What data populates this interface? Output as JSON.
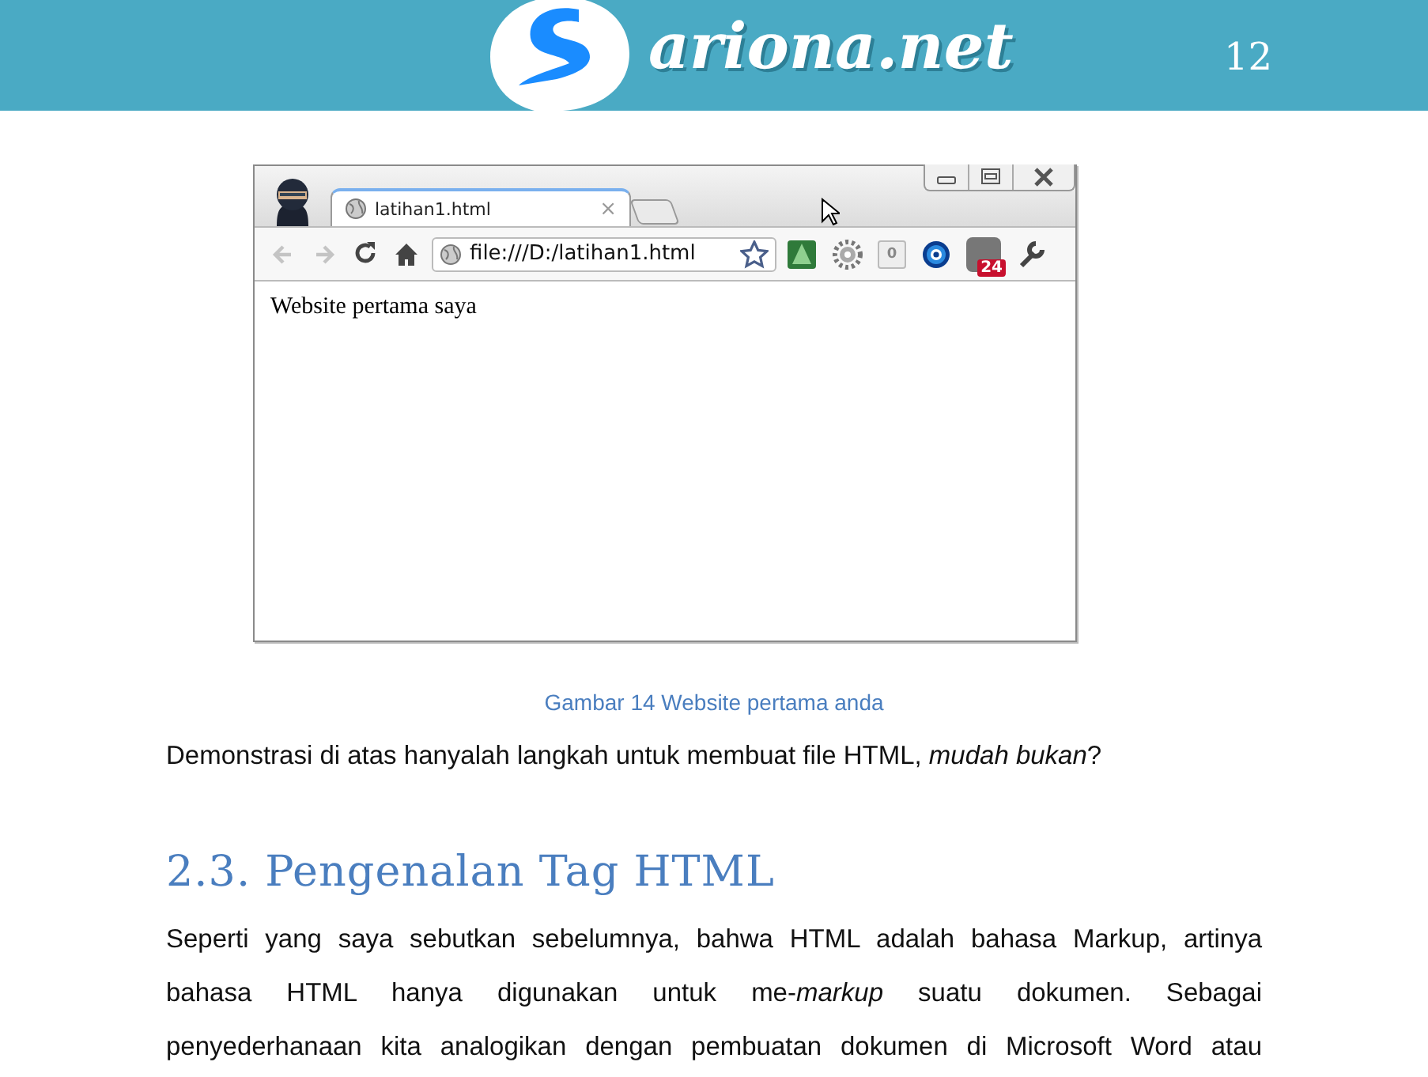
{
  "header": {
    "logo_text": "ariona.net",
    "page_number": "12"
  },
  "figure": {
    "browser": {
      "tab_title": "latihan1.html",
      "tab_close": "×",
      "address": "file:///D:/latihan1.html",
      "nav": [
        {
          "kind": "back",
          "disabled": true
        },
        {
          "kind": "forward",
          "disabled": true
        },
        {
          "kind": "reload",
          "disabled": false
        },
        {
          "kind": "home",
          "disabled": false
        }
      ],
      "extensions": [
        {
          "kind": "tree"
        },
        {
          "kind": "gear"
        },
        {
          "kind": "counter",
          "text": "0"
        },
        {
          "kind": "letter"
        },
        {
          "kind": "badge",
          "text": "24"
        },
        {
          "kind": "wrench"
        }
      ],
      "page_text": "Website pertama saya"
    },
    "caption": "Gambar 14 Website pertama anda"
  },
  "paragraph": "Demonstrasi di atas hanyalah langkah untuk membuat file HTML, *mudah bukan*?",
  "heading": "2.3. Pengenalan Tag HTML",
  "body": {
    "lines": [
      "Seperti yang saya sebutkan sebelumnya, bahwa HTML adalah bahasa Markup, artinya",
      "bahasa HTML hanya digunakan untuk me-*markup* suatu dokumen. Sebagai",
      "penyederhanaan kita analogikan dengan pembuatan dokumen di Microsoft Word atau"
    ]
  }
}
